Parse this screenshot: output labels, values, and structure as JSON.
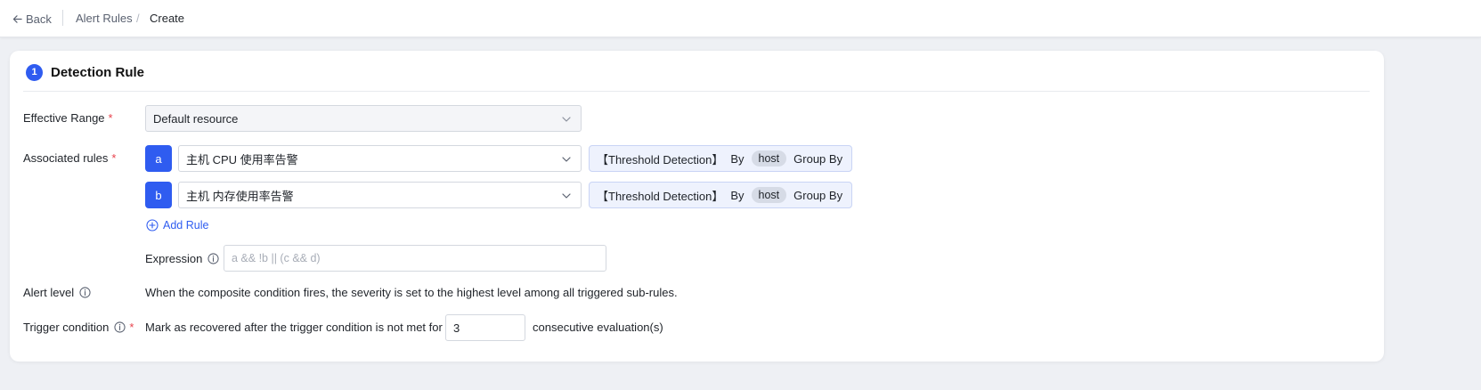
{
  "header": {
    "back_label": "Back",
    "breadcrumb": [
      "Alert Rules",
      "Create"
    ],
    "separator": "/"
  },
  "section": {
    "step": "1",
    "title": "Detection Rule"
  },
  "form": {
    "effective_range": {
      "label": "Effective Range",
      "required": "*",
      "value": "Default resource"
    },
    "associated_rules": {
      "label": "Associated rules",
      "required": "*",
      "rules": [
        {
          "tag": "a",
          "value": "主机 CPU 使用率告警",
          "method": "【Threshold Detection】",
          "by": "By",
          "group_field": "host",
          "group_by": "Group By"
        },
        {
          "tag": "b",
          "value": "主机 内存使用率告警",
          "method": "【Threshold Detection】",
          "by": "By",
          "group_field": "host",
          "group_by": "Group By"
        }
      ],
      "add_rule_label": "Add Rule"
    },
    "expression": {
      "label": "Expression",
      "value": "",
      "placeholder": "a && !b || (c && d)"
    },
    "alert_level": {
      "label": "Alert level",
      "description": "When the composite condition fires, the severity is set to the highest level among all triggered sub-rules."
    },
    "trigger_condition": {
      "label": "Trigger condition",
      "required": "*",
      "prefix": "Mark as recovered after the trigger condition is not met for",
      "value": "3",
      "suffix": "consecutive evaluation(s)"
    }
  },
  "colors": {
    "accent": "#2f5cf0",
    "required": "#e8424c",
    "method_bg": "#eef2fd"
  },
  "icons": {
    "back": "arrow-left-icon",
    "chevron": "chevron-down-icon",
    "info": "info-circle-icon",
    "add": "plus-circle-icon"
  }
}
